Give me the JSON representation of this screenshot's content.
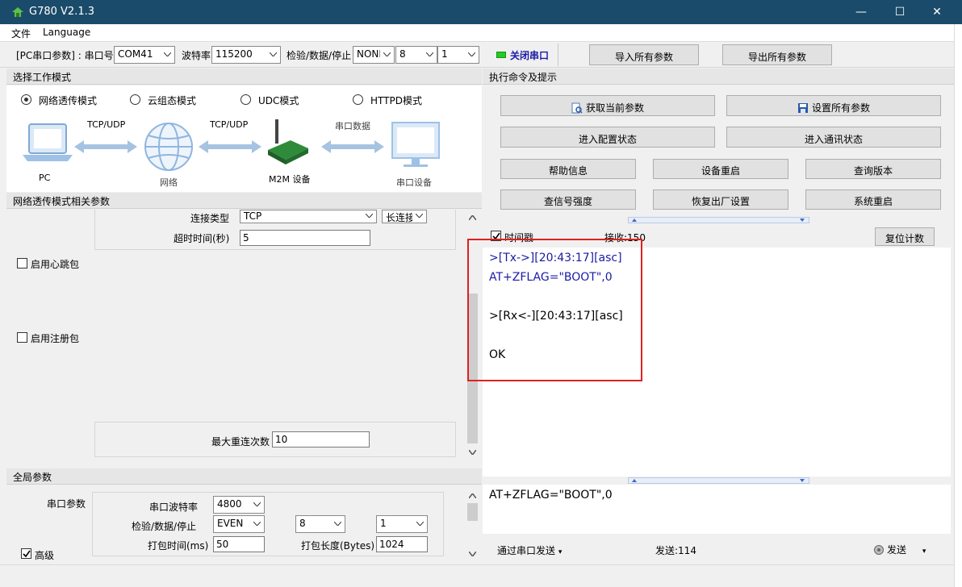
{
  "window": {
    "title": "G780 V2.1.3",
    "minimize": "—",
    "maximize": "☐",
    "close": "✕"
  },
  "menu": {
    "file": "文件",
    "language": "Language"
  },
  "toolbar": {
    "pc_serial_label": "[PC串口参数] : 串口号",
    "port_value": "COM41",
    "baud_label": "波特率",
    "baud_value": "115200",
    "check_label": "检验/数据/停止",
    "parity_value": "NONI",
    "data_value": "8",
    "stop_value": "1",
    "close_port_label": "关闭串口",
    "import_label": "导入所有参数",
    "export_label": "导出所有参数"
  },
  "work_mode": {
    "header": "选择工作模式",
    "options": [
      "网络透传模式",
      "云组态模式",
      "UDC模式",
      "HTTPD模式"
    ],
    "selected": 0,
    "diagram": {
      "pc": "PC",
      "net": "网络",
      "m2m": "M2M 设备",
      "serial_device": "串口设备",
      "link1": "TCP/UDP",
      "link2": "TCP/UDP",
      "link3": "串口数据"
    }
  },
  "params": {
    "header": "网络透传模式相关参数",
    "conn_type_label": "连接类型",
    "conn_type_value": "TCP",
    "conn_mode_value": "长连接",
    "timeout_label": "超时时间(秒)",
    "timeout_value": "5",
    "heartbeat_label": "启用心跳包",
    "register_label": "启用注册包",
    "max_reconnect_label": "最大重连次数",
    "max_reconnect_value": "10"
  },
  "global": {
    "header": "全局参数",
    "serial_params_label": "串口参数",
    "baud_label": "串口波特率",
    "baud_value": "4800",
    "check_label": "检验/数据/停止",
    "parity_value": "EVEN",
    "data_value": "8",
    "stop_value": "1",
    "pack_time_label": "打包时间(ms)",
    "pack_time_value": "50",
    "pack_len_label": "打包长度(Bytes)",
    "pack_len_value": "1024",
    "advanced_label": "高级"
  },
  "commands": {
    "header": "执行命令及提示",
    "get_params": "获取当前参数",
    "set_params": "设置所有参数",
    "enter_config": "进入配置状态",
    "enter_comm": "进入通讯状态",
    "help": "帮助信息",
    "reboot_device": "设备重启",
    "query_version": "查询版本",
    "query_signal": "查信号强度",
    "factory_reset": "恢复出厂设置",
    "system_reboot": "系统重启"
  },
  "log": {
    "timestamp_label": "时间戳",
    "recv_label": "接收:150",
    "reset_count": "复位计数",
    "lines": [
      {
        "text": ">[Tx->][20:43:17][asc]",
        "color": "#1a1aa6"
      },
      {
        "text": "AT+ZFLAG=\"BOOT\",0",
        "color": "#1a1aa6"
      },
      {
        "text": ">[Rx<-][20:43:17][asc]",
        "color": "#000000"
      },
      {
        "text": "OK",
        "color": "#000000"
      }
    ]
  },
  "send": {
    "input_value": "AT+ZFLAG=\"BOOT\",0",
    "via_serial": "通过串口发送",
    "sent_label": "发送:114",
    "send_button": "发送"
  },
  "colors": {
    "titlebar": "#1b4b6a",
    "highlight_box": "#e02020",
    "led": "#22cc22",
    "tx_text": "#1a1aa6"
  }
}
